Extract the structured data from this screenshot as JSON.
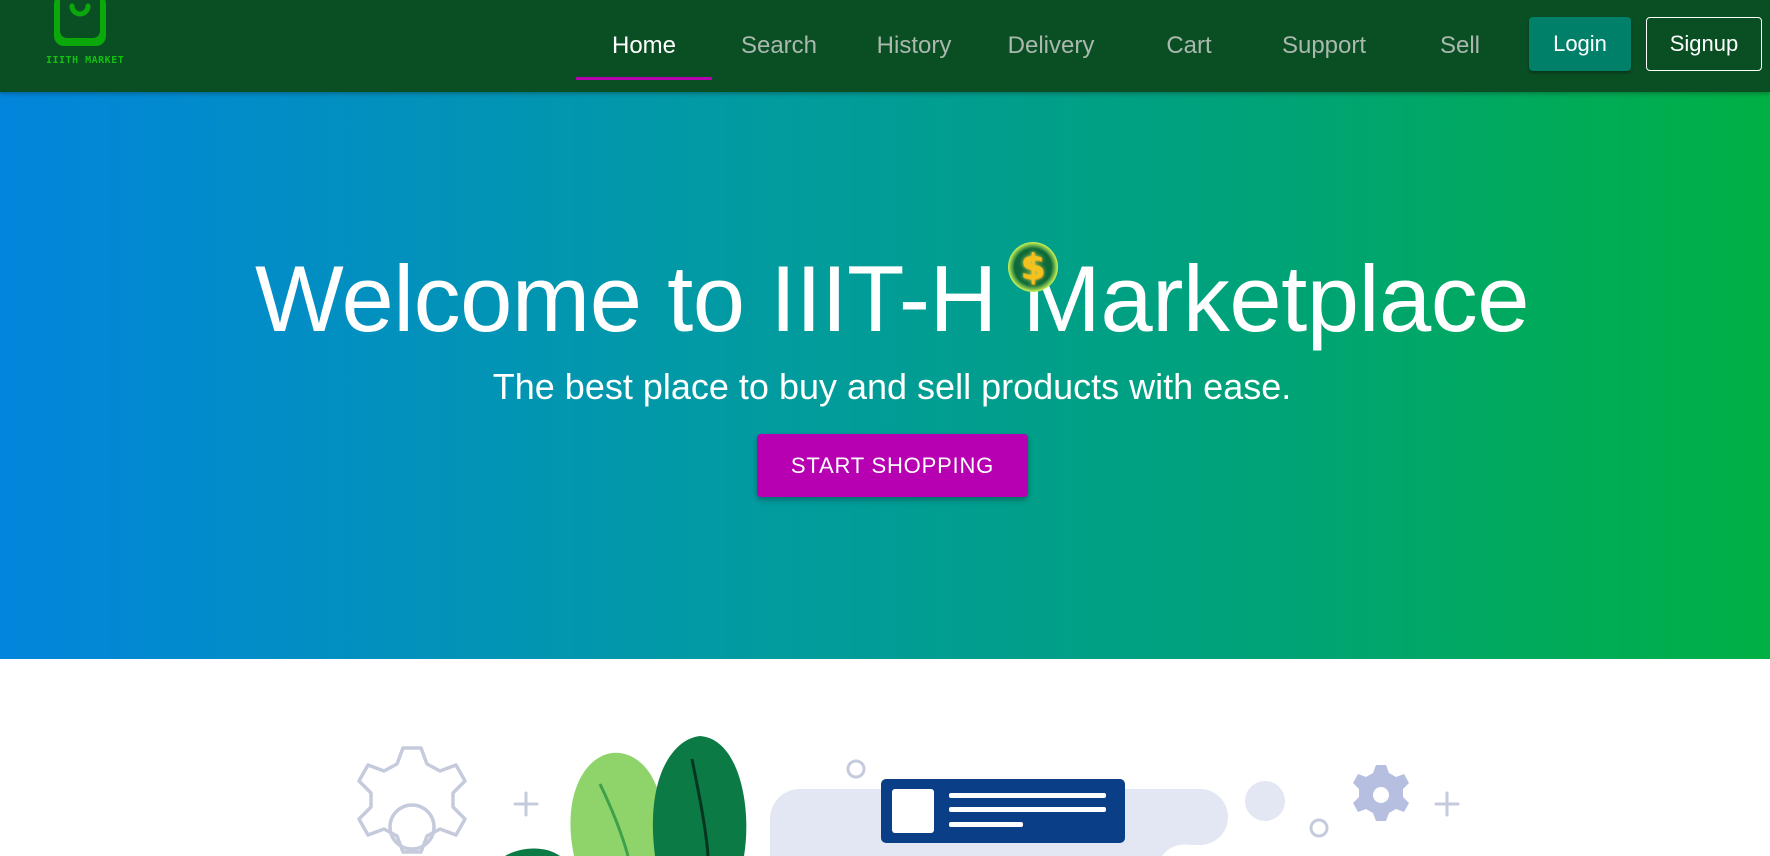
{
  "brand": {
    "logo_text": "IIITH MARKET",
    "logo_icon": "shopping-bag-logo-icon"
  },
  "nav": {
    "items": [
      {
        "label": "Home",
        "active": true
      },
      {
        "label": "Search",
        "active": false
      },
      {
        "label": "History",
        "active": false
      },
      {
        "label": "Delivery",
        "active": false
      },
      {
        "label": "Cart",
        "active": false
      },
      {
        "label": "Support",
        "active": false
      },
      {
        "label": "Sell",
        "active": false
      }
    ],
    "login_label": "Login",
    "signup_label": "Signup"
  },
  "hero": {
    "title": "Welcome to IIIT-H Marketplace",
    "subtitle": "The best place to buy and sell products with ease.",
    "cta_label": "START SHOPPING",
    "coin_icon": "dollar-coin-icon",
    "coin_glyph": "$"
  },
  "colors": {
    "navbar_bg": "#0a4f24",
    "active_indicator": "#b700b2",
    "login_button": "#008069",
    "cta_button": "#b700b2",
    "hero_gradient_start": "#0285dc",
    "hero_gradient_end": "#00b044"
  }
}
